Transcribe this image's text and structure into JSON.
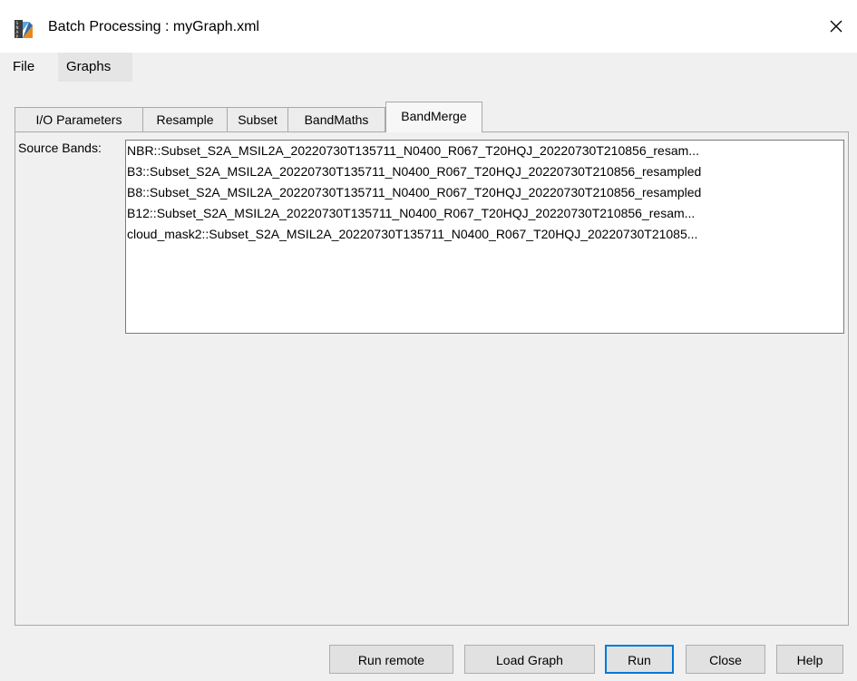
{
  "window": {
    "title": "Batch Processing : myGraph.xml",
    "app_icon": "snap-icon",
    "close_icon": "close-icon"
  },
  "menu": {
    "items": [
      {
        "label": "File"
      },
      {
        "label": "Graphs"
      }
    ]
  },
  "tabs": [
    {
      "label": "I/O Parameters",
      "active": false
    },
    {
      "label": "Resample",
      "active": false
    },
    {
      "label": "Subset",
      "active": false
    },
    {
      "label": "BandMaths",
      "active": false
    },
    {
      "label": "BandMerge",
      "active": true
    }
  ],
  "bandmerge": {
    "source_bands_label": "Source Bands:",
    "bands": [
      "NBR::Subset_S2A_MSIL2A_20220730T135711_N0400_R067_T20HQJ_20220730T210856_resam...",
      "B3::Subset_S2A_MSIL2A_20220730T135711_N0400_R067_T20HQJ_20220730T210856_resampled",
      "B8::Subset_S2A_MSIL2A_20220730T135711_N0400_R067_T20HQJ_20220730T210856_resampled",
      "B12::Subset_S2A_MSIL2A_20220730T135711_N0400_R067_T20HQJ_20220730T210856_resam...",
      "cloud_mask2::Subset_S2A_MSIL2A_20220730T135711_N0400_R067_T20HQJ_20220730T21085..."
    ]
  },
  "buttons": {
    "run_remote": "Run remote",
    "load_graph": "Load Graph",
    "run": "Run",
    "close": "Close",
    "help": "Help"
  },
  "colors": {
    "window_bg": "#f0f0f0",
    "titlebar_bg": "#ffffff",
    "default_button_border": "#0078d7"
  }
}
